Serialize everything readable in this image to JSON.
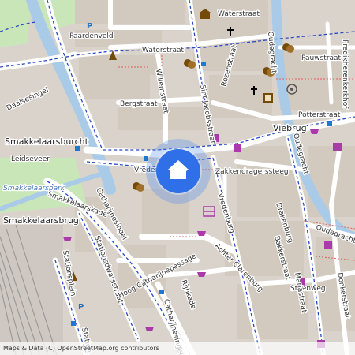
{
  "map": {
    "attribution": "Maps & Data (C) OpenStreetMap.org contributors",
    "marker_icon": "home-icon",
    "colors": {
      "road": "#ffffff",
      "water": "#a9cbe8",
      "building": "#d2c9bf",
      "park": "#c9e6b8",
      "marker": "#2f6fe8",
      "route_dashed": "#2a49c5"
    },
    "street_labels": {
      "waterstraat_top": "Waterstraat",
      "paardenveld": "Paardenveld",
      "waterstraat": "Waterstraat",
      "willemstraat": "Willemstraat",
      "bergstraat": "Bergstraat",
      "sint_jacobsstraat": "Sint Jacobsstraat",
      "rozenstraat": "Rozenstraat",
      "oudegracht_n": "Oudegracht",
      "pauwstraat": "Pauwstraat",
      "predikherenkerkhof": "Predikherenkerkhof",
      "potterstraat": "Potterstraat",
      "viebrug": "Viebrug",
      "daalsesingel": "Daalsesingel",
      "smakkelaarsburcht": "Smakkelaarsburcht",
      "leidseveer": "Leidseveer",
      "smakkelaarspark": "Smakkelaarspark",
      "smakkelaarskade": "Smakkelaarskade",
      "catharijnesingel": "Catharijnesingel",
      "vredenburg_w": "Vreden",
      "zakkendragerssteeg": "Zakkendragerssteeg",
      "vredenburg": "Vredenburg",
      "oudegracht_e": "Oudegracht",
      "oudegracht_se": "Oudegracht",
      "drakenburg": "Drakenburg",
      "smakkelaarsbrug": "Smakkelaarsbrug",
      "stationsplein": "Stationsplein",
      "stationsdwarsstraat": "Stationsdwarsstraat",
      "hoog_catharijne": "Hoog Catharijnepassage",
      "achter_clarenburg": "Achter Clarenburg",
      "bakkerstraat": "Bakkerstraat",
      "steenweg": "Steenweg",
      "mariastraat": "Mariastraat",
      "donkerstraat": "Donkerstraat",
      "rijnkade": "Rijnkade",
      "catharijnesingel_s": "Catharijnesingel",
      "stationsdwarsstr_s": "Station"
    },
    "poi_labels": {
      "parking": "P",
      "bus_stop": "P"
    }
  }
}
